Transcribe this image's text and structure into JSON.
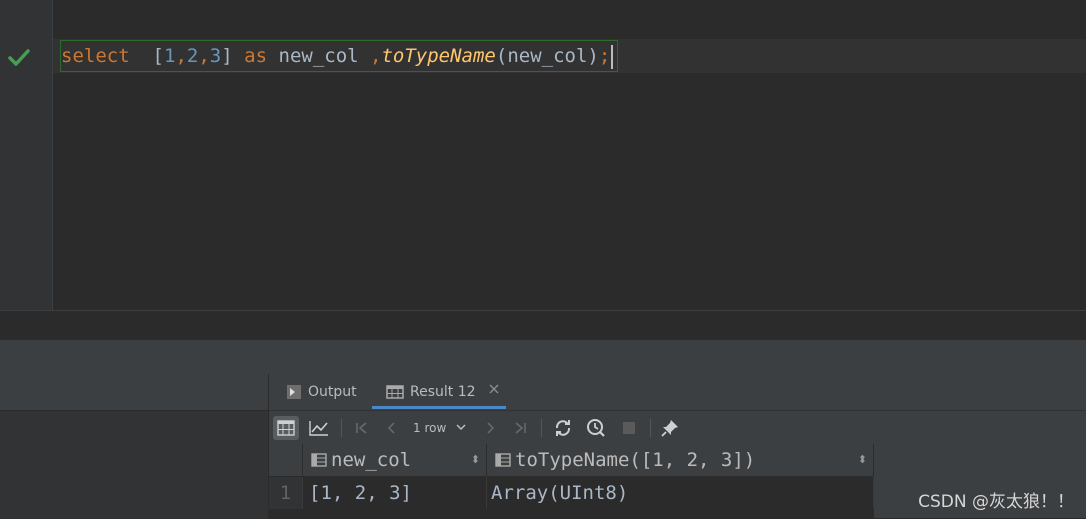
{
  "editor": {
    "statement": {
      "kw_select": "select",
      "lbracket": "[",
      "n1": "1",
      "c1": ",",
      "n2": "2",
      "c2": ",",
      "n3": "3",
      "rbracket": "]",
      "kw_as": "as",
      "alias": "new_col",
      "comma": ",",
      "func": "toTypeName",
      "args": "(new_col)",
      "semicolon": ";"
    }
  },
  "tabs": [
    {
      "label": "Output"
    },
    {
      "label": "Result 12"
    }
  ],
  "toolbar": {
    "rows_label": "1 row"
  },
  "grid": {
    "columns": [
      "new_col",
      "toTypeName([1, 2, 3])"
    ],
    "rows": [
      {
        "index": "1",
        "cells": [
          "[1, 2, 3]",
          "Array(UInt8)"
        ]
      }
    ]
  },
  "watermark": "CSDN @灰太狼！！",
  "colors": {
    "keyword": "#cc7832",
    "number": "#6897bb",
    "function": "#ffc66d",
    "accent": "#4a88c7",
    "success": "#499c54"
  }
}
